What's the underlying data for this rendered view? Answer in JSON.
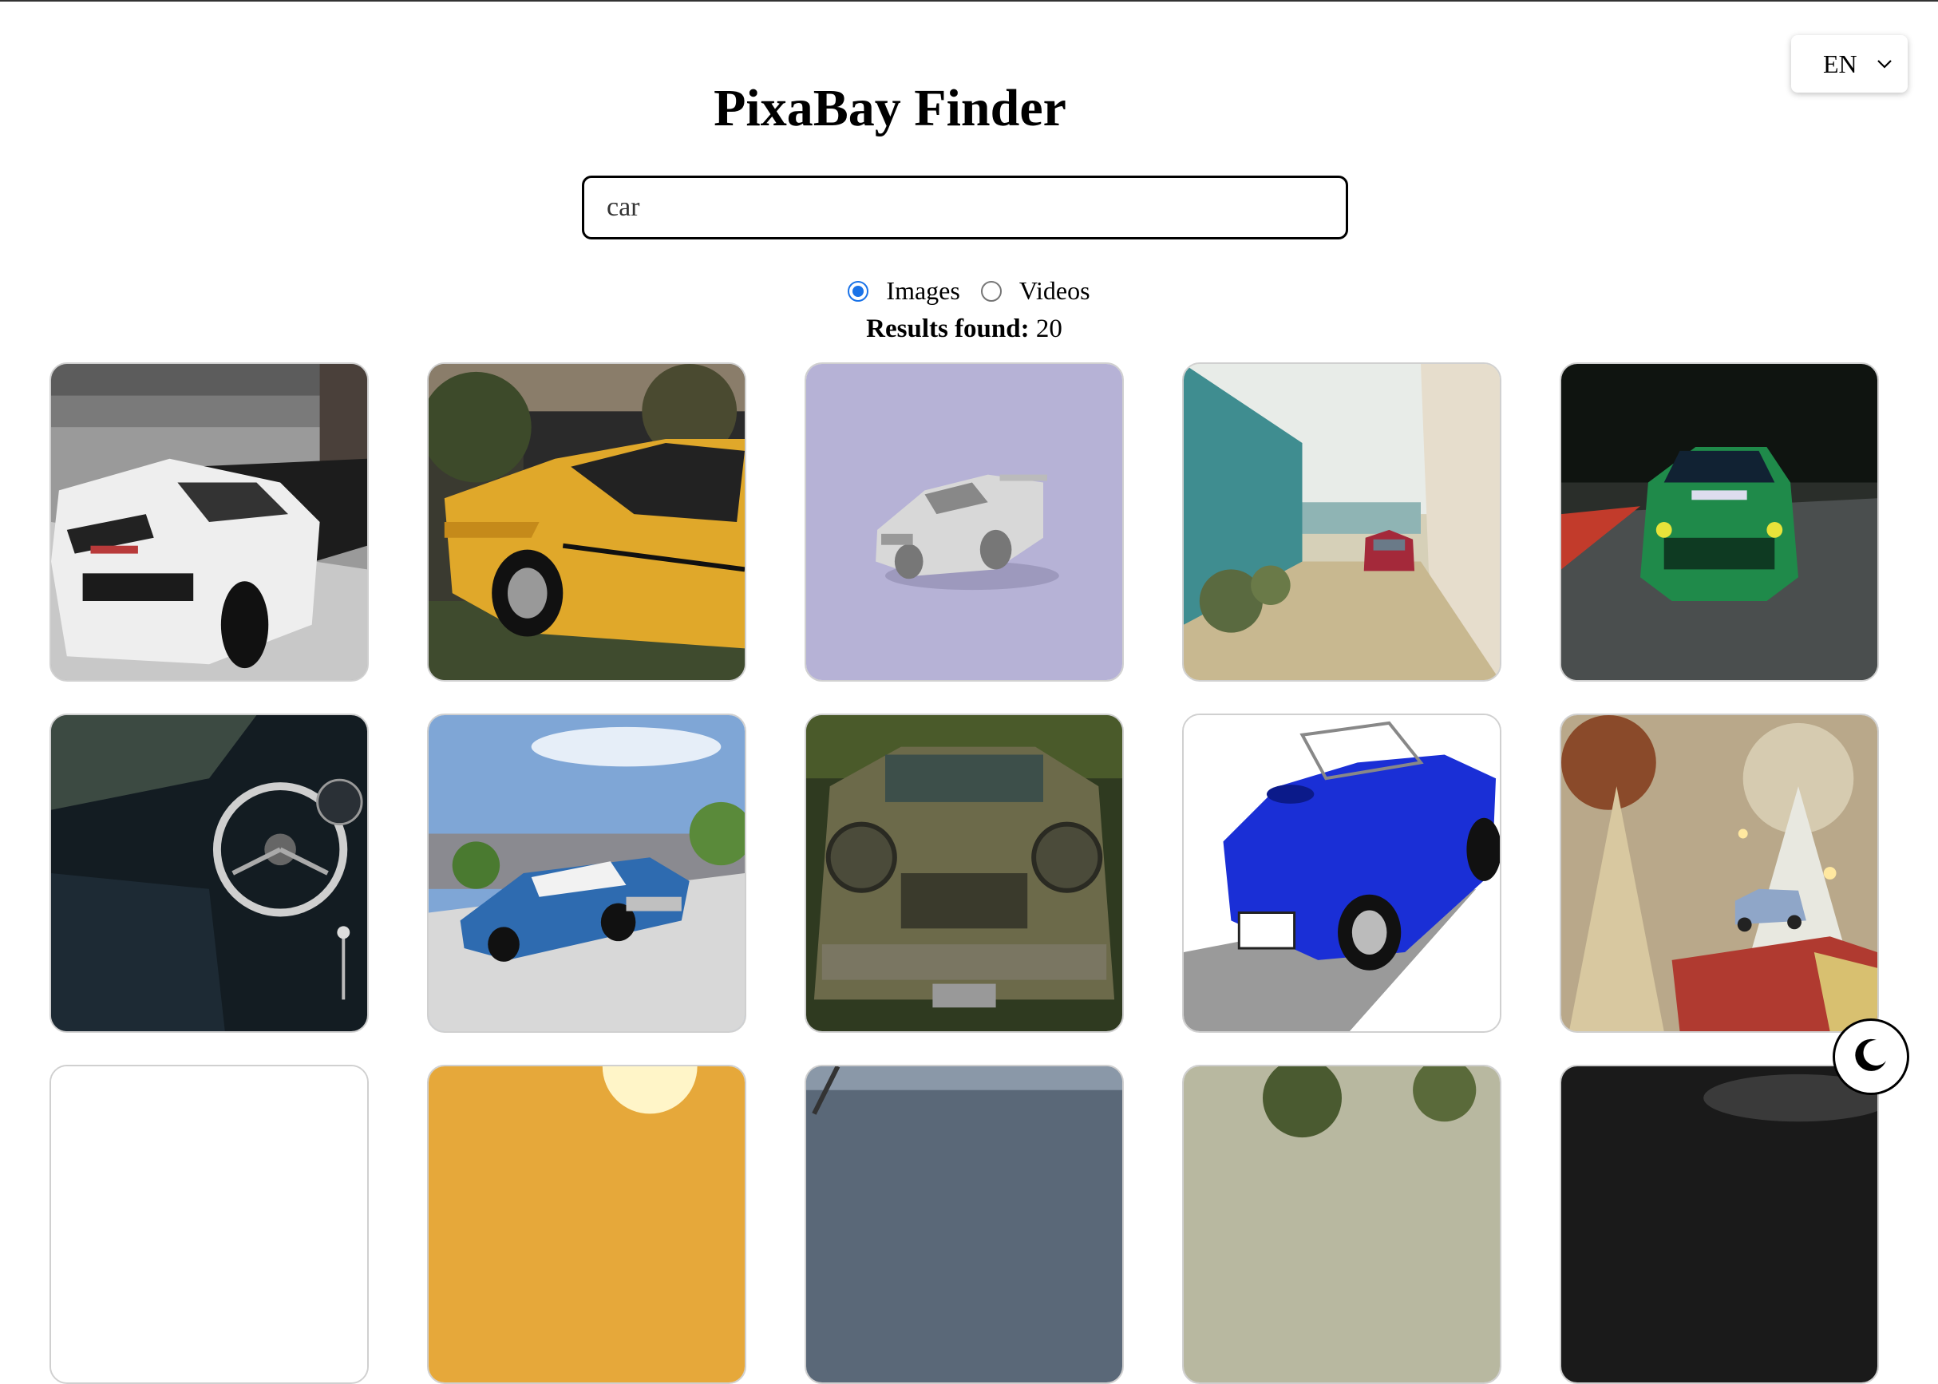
{
  "app": {
    "title": "PixaBay Finder"
  },
  "language": {
    "selected": "EN"
  },
  "search": {
    "value": "car"
  },
  "media_type": {
    "options": [
      {
        "label": "Images",
        "checked": true
      },
      {
        "label": "Videos",
        "checked": false
      }
    ]
  },
  "results": {
    "label": "Results found:",
    "count": "20"
  },
  "gallery": {
    "items": [
      {
        "name": "white-lamborghini-image"
      },
      {
        "name": "yellow-muscle-car-image"
      },
      {
        "name": "silver-3d-race-car-image"
      },
      {
        "name": "red-beetle-beach-alley-image"
      },
      {
        "name": "green-race-car-track-image"
      },
      {
        "name": "classic-car-interior-steering-wheel-image"
      },
      {
        "name": "blue-classic-buick-image"
      },
      {
        "name": "rusty-abandoned-car-forest-image"
      },
      {
        "name": "blue-cobra-roadster-illustration-image"
      },
      {
        "name": "toy-car-christmas-gift-image"
      },
      {
        "name": "result-image-11"
      },
      {
        "name": "result-image-12"
      },
      {
        "name": "result-image-13"
      },
      {
        "name": "result-image-14"
      },
      {
        "name": "result-image-15"
      }
    ]
  },
  "theme_toggle": {
    "icon": "moon-icon"
  },
  "colors": {
    "accent": "#1a73e8",
    "border": "#000000"
  }
}
